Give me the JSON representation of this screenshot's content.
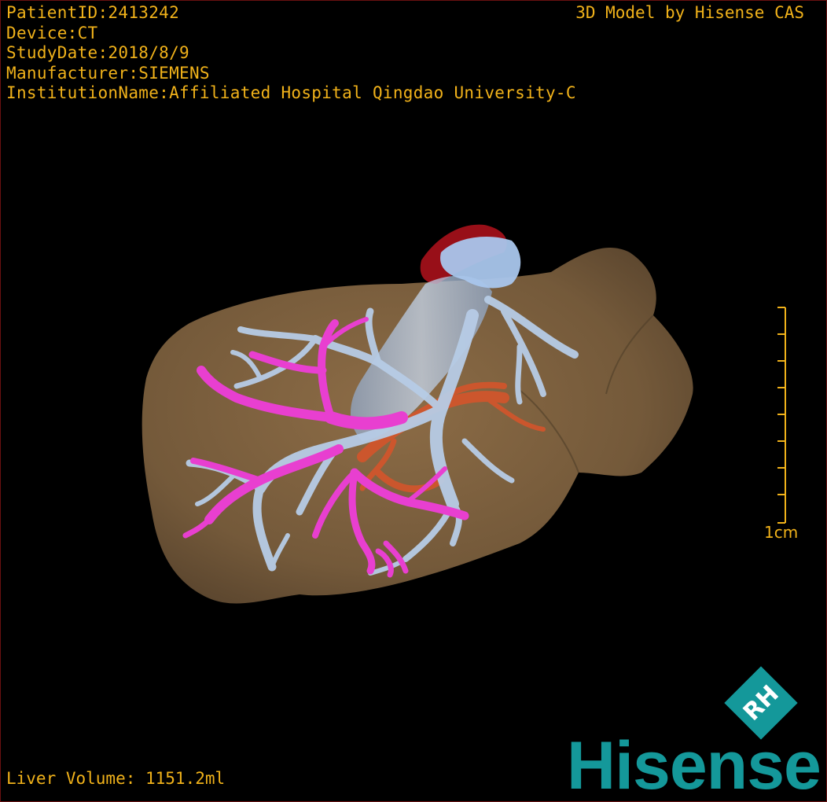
{
  "header": {
    "patient_id": "PatientID:2413242",
    "device": "Device:CT",
    "study_date": "StudyDate:2018/8/9",
    "manufacturer": "Manufacturer:SIEMENS",
    "institution": "InstitutionName:Affiliated Hospital Qingdao University-C"
  },
  "credit": "3D Model by Hisense CAS",
  "scale_bar": {
    "label": "1cm"
  },
  "footer": {
    "liver_volume": "Liver Volume: 1151.2ml"
  },
  "brand": {
    "name": "Hisense",
    "mark_text": "RH"
  },
  "colors": {
    "overlay_text": "#f1b21a",
    "liver": "#8a6a45",
    "portal_vein": "#b7cce6",
    "hepatic_vessels": "#e83fd0",
    "artery": "#d9542a",
    "ivc_top": "#a8111b",
    "brand": "#14989a"
  }
}
